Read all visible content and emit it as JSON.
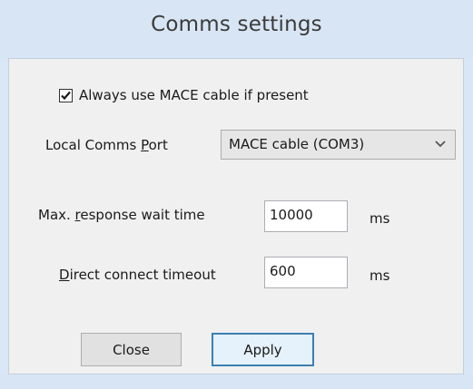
{
  "window": {
    "title": "Comms settings"
  },
  "checkbox": {
    "label": "Always use MACE cable if present",
    "checked": true
  },
  "local_port": {
    "label_pre": "Local Comms ",
    "label_mnemonic": "P",
    "label_post": "ort",
    "selected_value": "MACE cable (COM3)"
  },
  "response_wait": {
    "label_pre": "Max. ",
    "label_mnemonic": "r",
    "label_post": "esponse wait time",
    "value": "10000",
    "unit": "ms"
  },
  "direct_timeout": {
    "label_mnemonic": "D",
    "label_post": "irect connect timeout",
    "value": "600",
    "unit": "ms"
  },
  "buttons": {
    "close_label": "Close",
    "apply_label": "Apply"
  },
  "colors": {
    "frame": "#d9e6f5",
    "client": "#f0f0f0",
    "default_button_border": "#3c7fb1"
  }
}
